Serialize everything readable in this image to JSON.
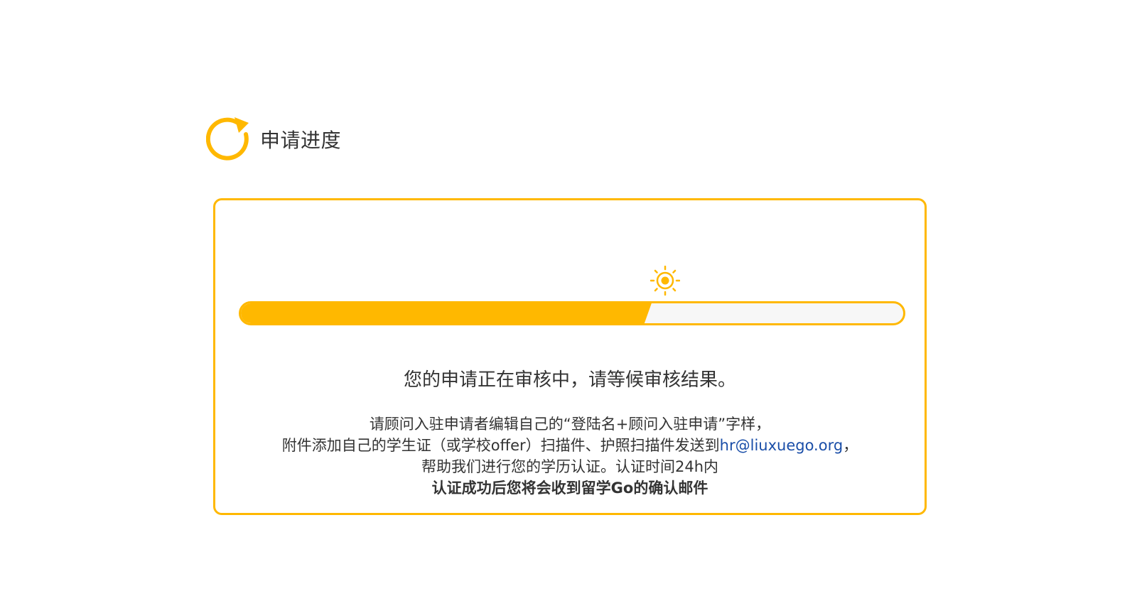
{
  "header": {
    "title": "申请进度",
    "icon": "refresh-icon"
  },
  "colors": {
    "accent": "#ffb800",
    "track": "#f7f7f7",
    "text": "#333333",
    "link": "#1a4ea8"
  },
  "progress": {
    "percent": 62,
    "marker_icon": "sun-icon"
  },
  "status": {
    "message": "您的申请正在审核中，请等候审核结果。"
  },
  "instructions": {
    "line1": "请顾问入驻申请者编辑自己的“登陆名+顾问入驻申请”字样，",
    "line2_prefix": "附件添加自己的学生证（或学校offer）扫描件、护照扫描件发送到",
    "email": "hr@liuxuego.org",
    "line2_suffix": "，",
    "line3": "帮助我们进行您的学历认证。认证时间24h内",
    "line4": "认证成功后您将会收到留学Go的确认邮件"
  }
}
